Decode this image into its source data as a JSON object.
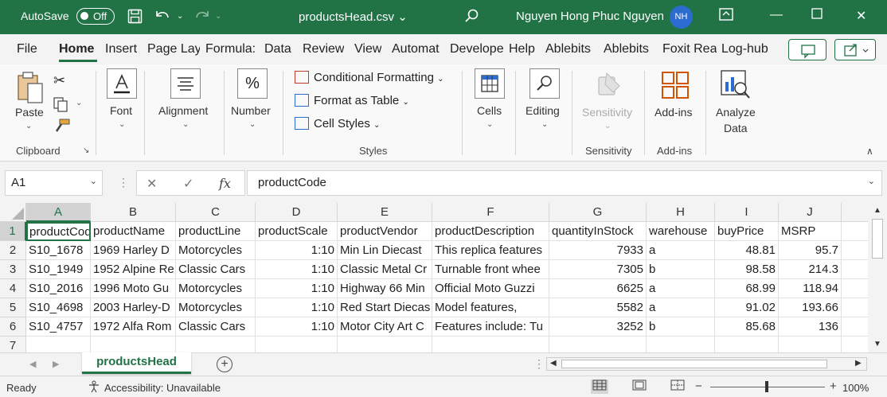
{
  "titlebar": {
    "autosave_label": "AutoSave",
    "autosave_state": "Off",
    "document_title": "productsHead.csv",
    "user_name": "Nguyen Hong Phuc Nguyen",
    "user_initials": "NH"
  },
  "menu": {
    "tabs": [
      "File",
      "Home",
      "Insert",
      "Page Lay",
      "Formula:",
      "Data",
      "Review",
      "View",
      "Automat",
      "Develope",
      "Help",
      "Ablebits",
      "Ablebits",
      "Foxit Rea",
      "Log-hub"
    ],
    "active_tab": "Home"
  },
  "ribbon": {
    "clipboard": {
      "paste_label": "Paste",
      "group_label": "Clipboard"
    },
    "font": {
      "label": "Font"
    },
    "alignment": {
      "label": "Alignment"
    },
    "number": {
      "label": "Number"
    },
    "styles": {
      "conditional_formatting": "Conditional Formatting",
      "format_as_table": "Format as Table",
      "cell_styles": "Cell Styles",
      "group_label": "Styles"
    },
    "cells": {
      "label": "Cells"
    },
    "editing": {
      "label": "Editing"
    },
    "sensitivity": {
      "button_label": "Sensitivity",
      "group_label": "Sensitivity"
    },
    "addins": {
      "button_label": "Add-ins",
      "group_label": "Add-ins"
    },
    "analyze": {
      "line1": "Analyze",
      "line2": "Data"
    }
  },
  "formula_bar": {
    "name_box": "A1",
    "formula": "productCode",
    "fx": "fx"
  },
  "grid": {
    "columns": [
      "A",
      "B",
      "C",
      "D",
      "E",
      "F",
      "G",
      "H",
      "I",
      "J"
    ],
    "rows": [
      "1",
      "2",
      "3",
      "4",
      "5",
      "6",
      "7"
    ],
    "data": [
      [
        "productCode",
        "productName",
        "productLine",
        "productScale",
        "productVendor",
        "productDescription",
        "quantityInStock",
        "warehouse",
        "buyPrice",
        "MSRP"
      ],
      [
        "S10_1678",
        "1969 Harley D",
        "Motorcycles",
        "1:10",
        "Min Lin Diecast",
        "This replica features",
        "7933",
        "a",
        "48.81",
        "95.7"
      ],
      [
        "S10_1949",
        "1952 Alpine Re",
        "Classic Cars",
        "1:10",
        "Classic Metal Cr",
        "Turnable front whee",
        "7305",
        "b",
        "98.58",
        "214.3"
      ],
      [
        "S10_2016",
        "1996 Moto Gu",
        "Motorcycles",
        "1:10",
        "Highway 66 Min",
        "Official Moto Guzzi",
        "6625",
        "a",
        "68.99",
        "118.94"
      ],
      [
        "S10_4698",
        "2003 Harley-D",
        "Motorcycles",
        "1:10",
        "Red Start Diecas",
        "Model features,",
        "5582",
        "a",
        "91.02",
        "193.66"
      ],
      [
        "S10_4757",
        "1972 Alfa Rom",
        "Classic Cars",
        "1:10",
        "Motor City Art C",
        "Features include: Tu",
        "3252",
        "b",
        "85.68",
        "136"
      ],
      [
        "",
        "",
        "",
        "",
        "",
        "",
        "",
        "",
        "",
        ""
      ]
    ]
  },
  "sheets": {
    "active": "productsHead"
  },
  "statusbar": {
    "ready": "Ready",
    "accessibility": "Accessibility: Unavailable",
    "zoom": "100%"
  },
  "colors": {
    "accent": "#217346"
  }
}
